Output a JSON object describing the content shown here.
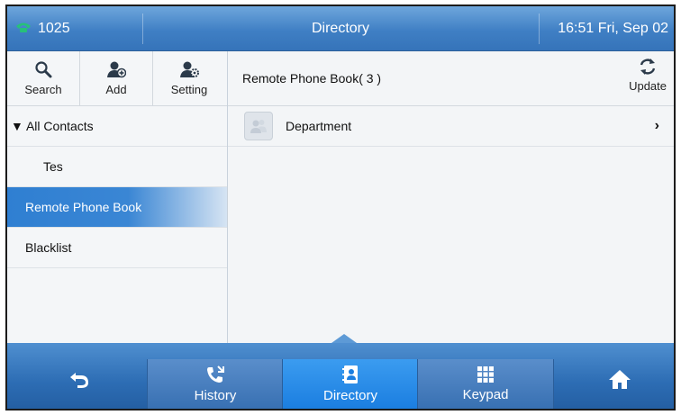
{
  "status_bar": {
    "extension": "1025",
    "title": "Directory",
    "datetime": "16:51 Fri, Sep 02"
  },
  "toolbar": {
    "search_label": "Search",
    "add_label": "Add",
    "setting_label": "Setting"
  },
  "sidebar": {
    "items": [
      {
        "label": "▼ All Contacts"
      },
      {
        "label": "Tes"
      },
      {
        "label": "Remote Phone Book",
        "active": true
      },
      {
        "label": "Blacklist"
      }
    ]
  },
  "main": {
    "title": "Remote Phone Book( 3 )",
    "update_label": "Update",
    "entries": [
      {
        "label": "Department"
      }
    ]
  },
  "bottom_nav": {
    "tabs": [
      {
        "label": "History",
        "icon": "history-icon"
      },
      {
        "label": "Directory",
        "icon": "directory-icon",
        "active": true
      },
      {
        "label": "Keypad",
        "icon": "keypad-icon"
      }
    ]
  },
  "colors": {
    "accent": "#2f7fd2",
    "phone_icon": "#27c07a"
  }
}
